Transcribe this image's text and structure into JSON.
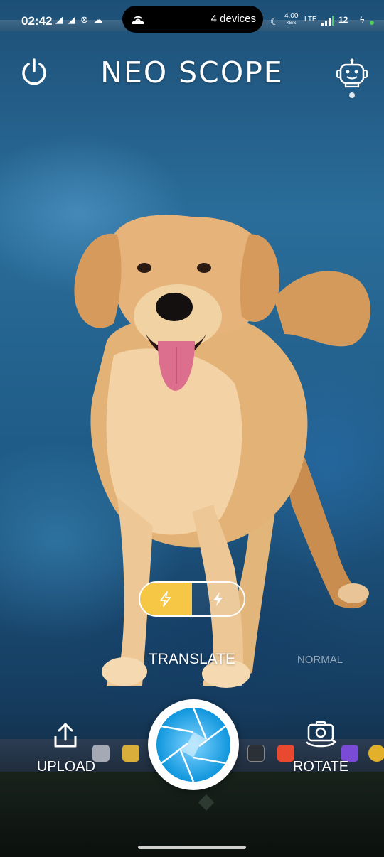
{
  "status_bar": {
    "time": "02:42",
    "left_icons": "◢ ◢ ⊗ ☁",
    "island_text": "4 devices",
    "net_speed": "4.00",
    "net_unit": "KB/S",
    "network": "LTE",
    "battery": "12"
  },
  "header": {
    "title": "NEO SCOPE"
  },
  "mode_toggle": {
    "left_icon": "lightning-bolt-icon",
    "right_icon": "lightning-bolt-icon",
    "active_color": "#f6c744"
  },
  "modes": {
    "translate": "TRANSLATE",
    "normal": "NORMAL"
  },
  "controls": {
    "upload_label": "UPLOAD",
    "rotate_label": "ROTATE",
    "shutter_color": "#1ea6e8"
  }
}
